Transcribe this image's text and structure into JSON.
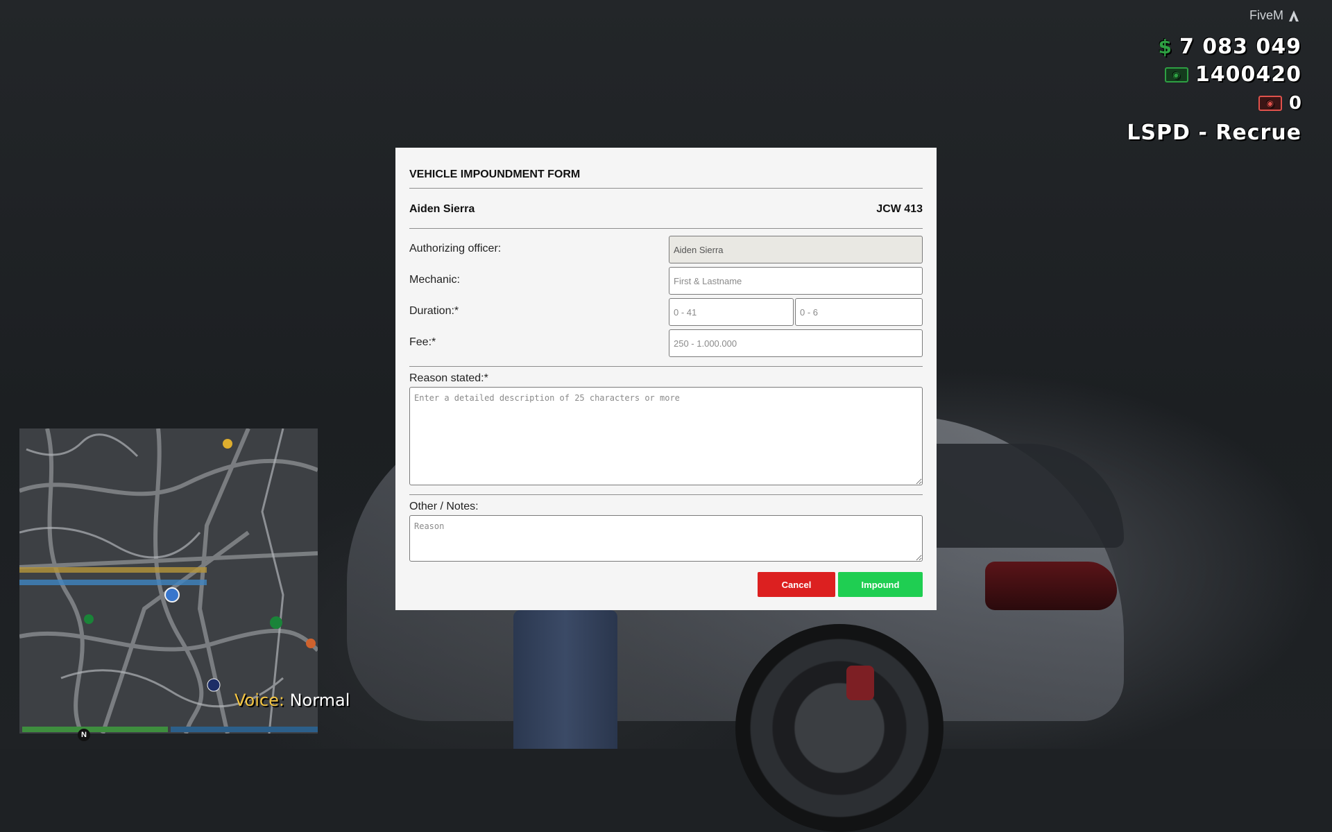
{
  "hud": {
    "brand": "FiveM",
    "money": "7 083 049",
    "money_symbol": "$",
    "bank": "1400420",
    "dirty_money": "0",
    "job": "LSPD - Recrue",
    "voice_label": "Voice:",
    "voice_mode": "Normal",
    "compass": "N",
    "colors": {
      "cash_green": "#2ea043",
      "dirty_red": "#e0524c",
      "health": "#3e8e3e",
      "armor": "#2c5f8a"
    }
  },
  "modal": {
    "title": "VEHICLE IMPOUNDMENT FORM",
    "person_name": "Aiden Sierra",
    "plate": "JCW 413",
    "fields": {
      "authorizing_officer": {
        "label": "Authorizing officer:",
        "value": "Aiden Sierra"
      },
      "mechanic": {
        "label": "Mechanic:",
        "placeholder": "First & Lastname"
      },
      "duration": {
        "label": "Duration:*",
        "placeholder_1": "0 - 41",
        "placeholder_2": "0 - 6"
      },
      "fee": {
        "label": "Fee:*",
        "placeholder": "250 - 1.000.000"
      },
      "reason": {
        "label": "Reason stated:*",
        "placeholder": "Enter a detailed description of 25 characters or more"
      },
      "notes": {
        "label": "Other / Notes:",
        "placeholder": "Reason"
      }
    },
    "buttons": {
      "cancel": "Cancel",
      "impound": "Impound"
    },
    "colors": {
      "cancel": "#dc2020",
      "impound": "#1fce52"
    }
  }
}
